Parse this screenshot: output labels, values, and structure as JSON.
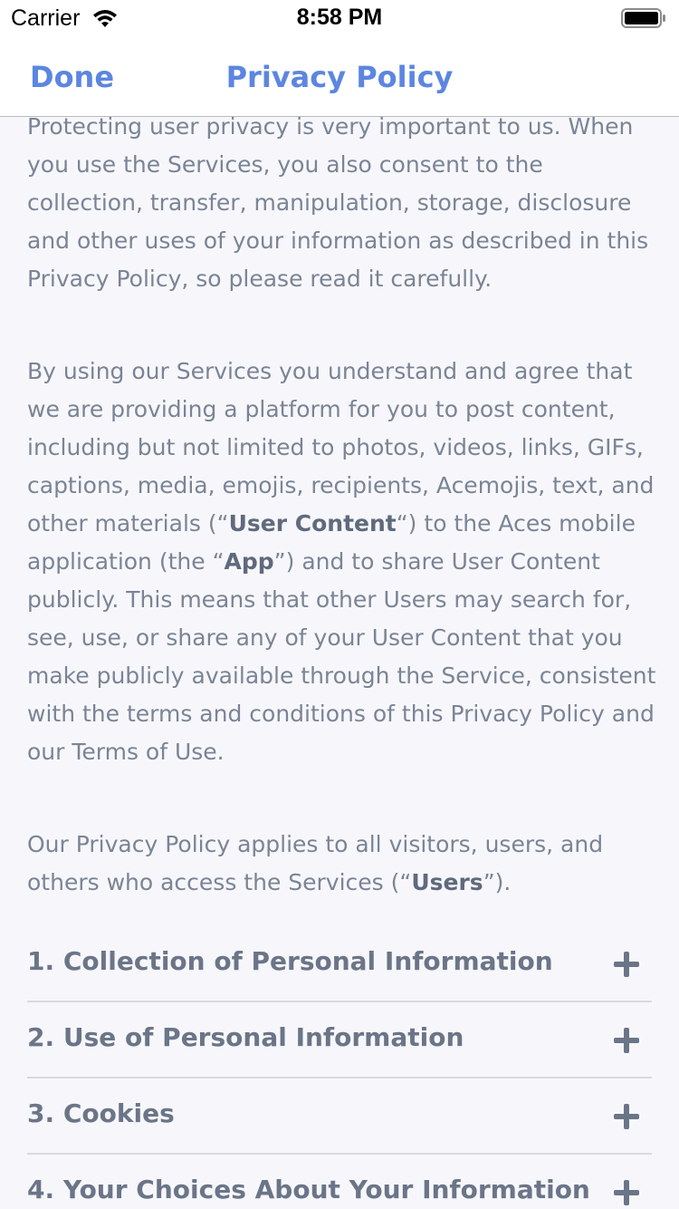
{
  "status_bar": {
    "carrier": "Carrier",
    "time": "8:58 PM"
  },
  "nav": {
    "done_label": "Done",
    "title": "Privacy Policy"
  },
  "content": {
    "p1": "Protecting user privacy is very important to us. When you use the Services, you also consent to the collection, transfer, manipulation, storage, disclosure and other uses of your information as described in this Privacy Policy, so please read it carefully.",
    "p2_a": "By using our Services you understand and agree that we are providing a platform for you to post content, including but not limited to photos, videos, links, GIFs, captions, media, emojis, recipients, Acemojis, text, and other materials (“",
    "p2_b": "User Content",
    "p2_c": "“) to the Aces mobile application (the “",
    "p2_d": "App",
    "p2_e": "”) and to share User Content publicly. This means that other Users may search for, see, use, or share any of your User Content that you make publicly available through the Service, consistent with the terms and conditions of this Privacy Policy and our Terms of Use.",
    "p3_a": "Our Privacy Policy applies to all visitors, users, and others who access the Services (“",
    "p3_b": "Users",
    "p3_c": "”)."
  },
  "sections": [
    {
      "title": "1. Collection of Personal Information"
    },
    {
      "title": "2. Use of Personal Information"
    },
    {
      "title": "3. Cookies"
    },
    {
      "title": "4. Your Choices About Your Information"
    }
  ],
  "icons": {
    "wifi": "wifi-icon",
    "battery": "battery-icon",
    "expand": "plus-icon"
  },
  "colors": {
    "accent": "#5c86e0",
    "body_text": "#7a8496",
    "section_title": "#6b7588"
  }
}
